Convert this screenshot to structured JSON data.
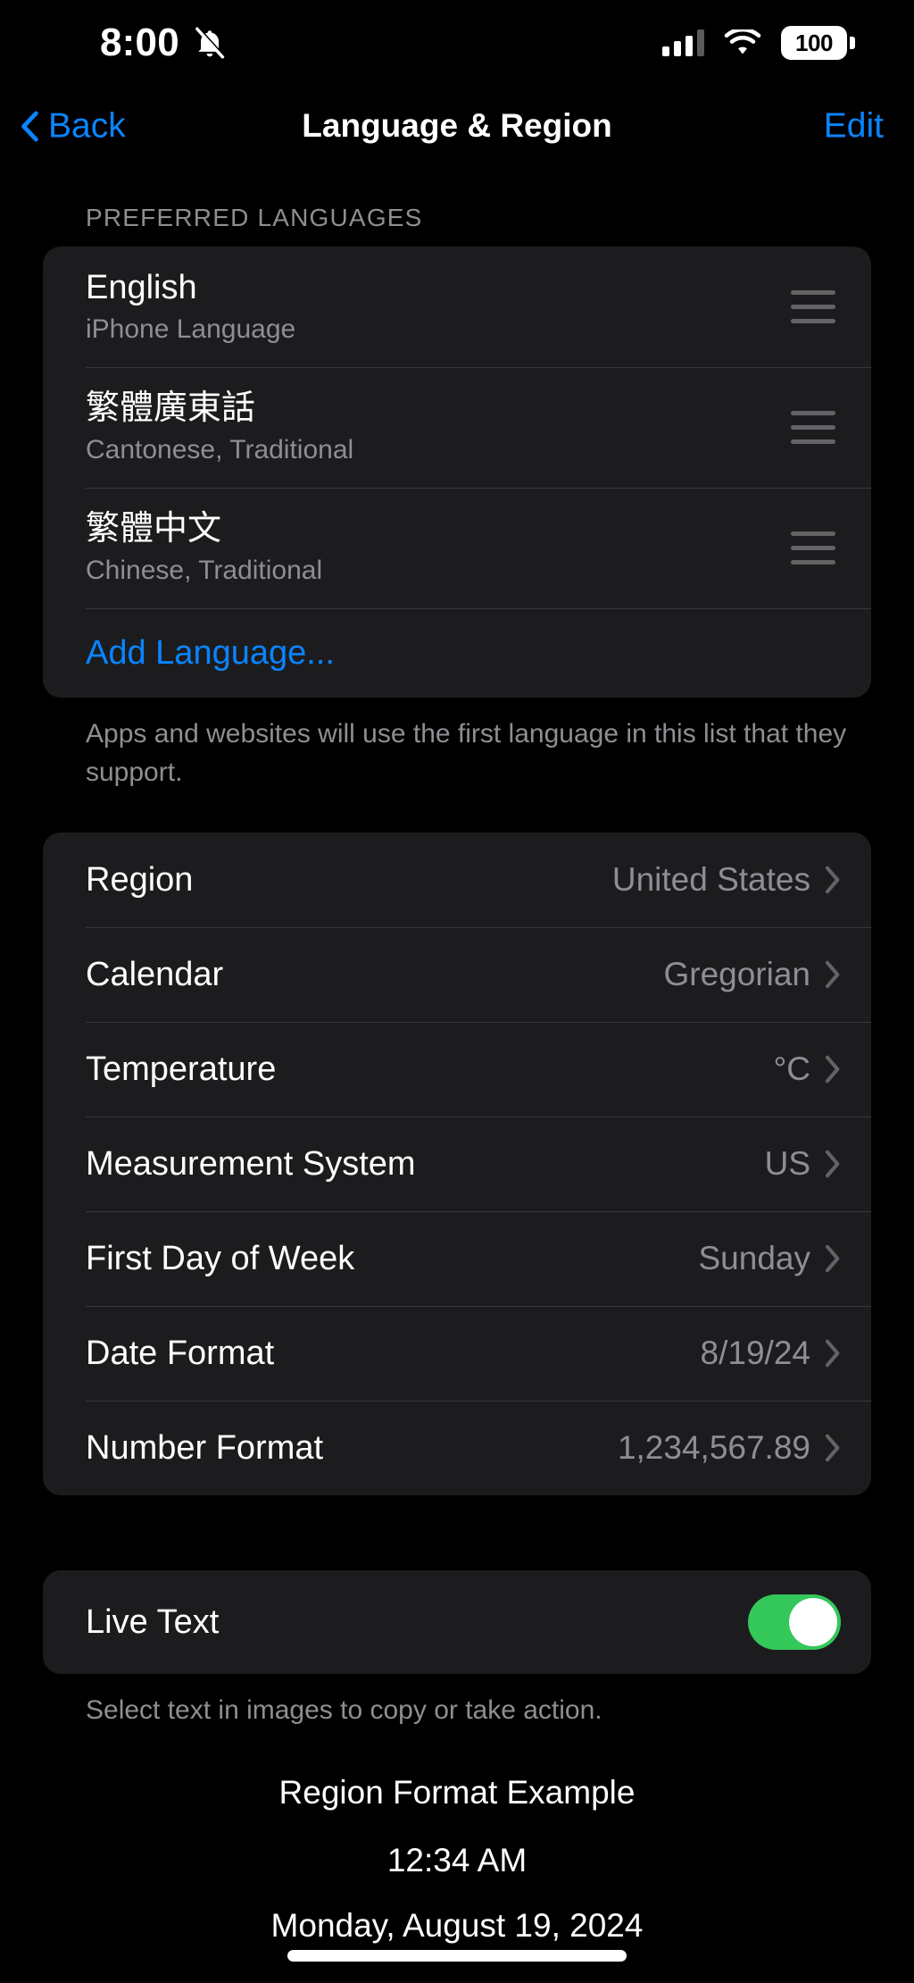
{
  "status_bar": {
    "time": "8:00",
    "silent_icon": "bell-slash-icon",
    "cellular_icon": "cellular-signal-icon",
    "cellular_bars_filled": 3,
    "cellular_bars_total": 4,
    "wifi_icon": "wifi-icon",
    "battery_percent": "100"
  },
  "nav": {
    "back_label": "Back",
    "title": "Language & Region",
    "edit_label": "Edit"
  },
  "languages_section": {
    "header": "PREFERRED LANGUAGES",
    "items": [
      {
        "name": "English",
        "subtitle": "iPhone Language"
      },
      {
        "name": "繁體廣東話",
        "subtitle": "Cantonese, Traditional"
      },
      {
        "name": "繁體中文",
        "subtitle": "Chinese, Traditional"
      }
    ],
    "add_label": "Add Language...",
    "footnote": "Apps and websites will use the first language in this list that they support."
  },
  "region_section": {
    "rows": [
      {
        "label": "Region",
        "value": "United States"
      },
      {
        "label": "Calendar",
        "value": "Gregorian"
      },
      {
        "label": "Temperature",
        "value": "°C"
      },
      {
        "label": "Measurement System",
        "value": "US"
      },
      {
        "label": "First Day of Week",
        "value": "Sunday"
      },
      {
        "label": "Date Format",
        "value": "8/19/24"
      },
      {
        "label": "Number Format",
        "value": "1,234,567.89"
      }
    ]
  },
  "live_text_section": {
    "label": "Live Text",
    "enabled": true,
    "footnote": "Select text in images to copy or take action."
  },
  "example_section": {
    "title": "Region Format Example",
    "time": "12:34 AM",
    "date": "Monday, August 19, 2024"
  },
  "colors": {
    "accent_blue": "#0a84ff",
    "toggle_green": "#34c759",
    "card_background": "#1c1c1e",
    "secondary_text": "#8e8e93",
    "background": "#000000"
  }
}
